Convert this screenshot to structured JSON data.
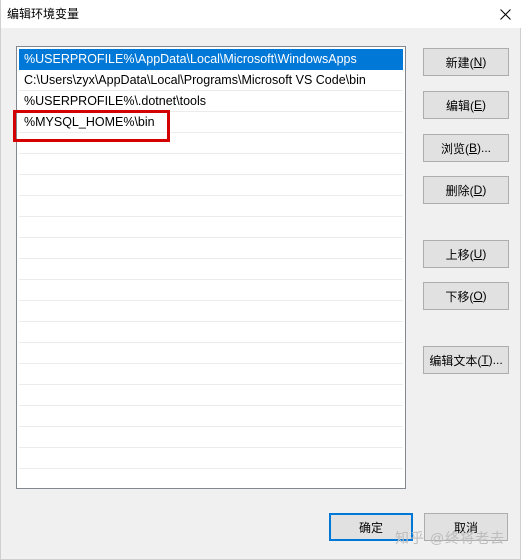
{
  "window": {
    "title": "编辑环境变量"
  },
  "list": {
    "items": [
      "%USERPROFILE%\\AppData\\Local\\Microsoft\\WindowsApps",
      "C:\\Users\\zyx\\AppData\\Local\\Programs\\Microsoft VS Code\\bin",
      "%USERPROFILE%\\.dotnet\\tools",
      "%MYSQL_HOME%\\bin"
    ],
    "selected_index": 0
  },
  "buttons": {
    "new": {
      "label": "新建(",
      "key": "N",
      "close": ")"
    },
    "edit": {
      "label": "编辑(",
      "key": "E",
      "close": ")"
    },
    "browse": {
      "label": "浏览(",
      "key": "B",
      "close": ")..."
    },
    "delete": {
      "label": "删除(",
      "key": "D",
      "close": ")"
    },
    "move_up": {
      "label": "上移(",
      "key": "U",
      "close": ")"
    },
    "move_down": {
      "label": "下移(",
      "key": "O",
      "close": ")"
    },
    "edit_text": {
      "label": "编辑文本(",
      "key": "T",
      "close": ")..."
    },
    "ok": {
      "label": "确定"
    },
    "cancel": {
      "label": "取消"
    }
  },
  "watermark": {
    "text": "知乎 @终将老去"
  },
  "colors": {
    "selection": "#0078d7",
    "highlight_box": "#d40000",
    "dialog_bg": "#f0f0f0"
  }
}
